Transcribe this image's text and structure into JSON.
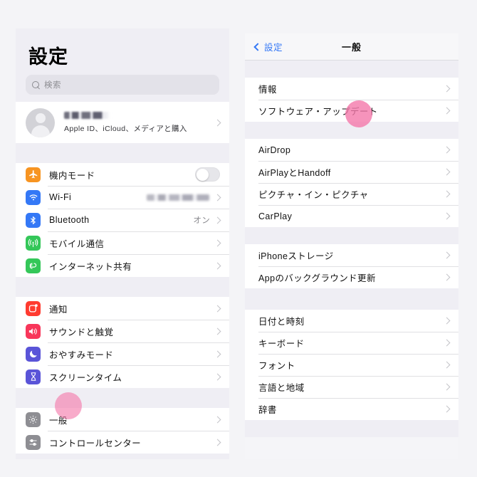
{
  "sidebar": {
    "title": "設定",
    "search": {
      "placeholder": "検索",
      "icon": "search-icon"
    },
    "account": {
      "name_redacted": true,
      "subtitle": "Apple ID、iCloud、メディアと購入",
      "chevron": "chevron-right-icon",
      "avatar": "person-avatar-icon"
    },
    "groups": [
      {
        "id": "connectivity",
        "items": [
          {
            "label": "機内モード",
            "icon": "airplane-icon",
            "icon_color": "#f79421",
            "control": "toggle",
            "toggle_on": false
          },
          {
            "label": "Wi-Fi",
            "icon": "wifi-icon",
            "icon_color": "#3478f6",
            "value_redacted": true,
            "control": "chevron"
          },
          {
            "label": "Bluetooth",
            "icon": "bluetooth-icon",
            "icon_color": "#3478f6",
            "value": "オン",
            "control": "chevron"
          },
          {
            "label": "モバイル通信",
            "icon": "cellular-icon",
            "icon_color": "#34c759",
            "control": "chevron"
          },
          {
            "label": "インターネット共有",
            "icon": "hotspot-icon",
            "icon_color": "#34c759",
            "control": "chevron"
          }
        ]
      },
      {
        "id": "alerts",
        "items": [
          {
            "label": "通知",
            "icon": "notification-icon",
            "icon_color": "#ff3b30",
            "control": "chevron"
          },
          {
            "label": "サウンドと触覚",
            "icon": "sound-icon",
            "icon_color": "#f8365a",
            "control": "chevron"
          },
          {
            "label": "おやすみモード",
            "icon": "moon-icon",
            "icon_color": "#5a54d8",
            "control": "chevron"
          },
          {
            "label": "スクリーンタイム",
            "icon": "hourglass-icon",
            "icon_color": "#5a54d8",
            "control": "chevron"
          }
        ]
      },
      {
        "id": "system",
        "items": [
          {
            "label": "一般",
            "icon": "gear-icon",
            "icon_color": "#8e8e93",
            "control": "chevron",
            "highlighted": true
          },
          {
            "label": "コントロールセンター",
            "icon": "control-center-icon",
            "icon_color": "#8e8e93",
            "control": "chevron"
          }
        ]
      }
    ]
  },
  "detail": {
    "nav": {
      "back_label": "設定",
      "back_icon": "chevron-left-icon",
      "title": "一般"
    },
    "groups": [
      {
        "id": "info",
        "items": [
          {
            "label": "情報",
            "control": "chevron"
          },
          {
            "label": "ソフトウェア・アップデート",
            "control": "chevron",
            "highlighted": true
          }
        ]
      },
      {
        "id": "sharing",
        "items": [
          {
            "label": "AirDrop",
            "control": "chevron"
          },
          {
            "label": "AirPlayとHandoff",
            "control": "chevron"
          },
          {
            "label": "ピクチャ・イン・ピクチャ",
            "control": "chevron"
          },
          {
            "label": "CarPlay",
            "control": "chevron"
          }
        ]
      },
      {
        "id": "storage",
        "items": [
          {
            "label": "iPhoneストレージ",
            "control": "chevron"
          },
          {
            "label": "Appのバックグラウンド更新",
            "control": "chevron"
          }
        ]
      },
      {
        "id": "locale",
        "items": [
          {
            "label": "日付と時刻",
            "control": "chevron"
          },
          {
            "label": "キーボード",
            "control": "chevron"
          },
          {
            "label": "フォント",
            "control": "chevron"
          },
          {
            "label": "言語と地域",
            "control": "chevron"
          },
          {
            "label": "辞書",
            "control": "chevron"
          }
        ]
      }
    ]
  },
  "annotations": {
    "highlight_color": "#f478aa",
    "dots": [
      {
        "name": "general-highlight",
        "target": "一般"
      },
      {
        "name": "software-update-highlight",
        "target": "ソフトウェア・アップデート"
      }
    ]
  }
}
